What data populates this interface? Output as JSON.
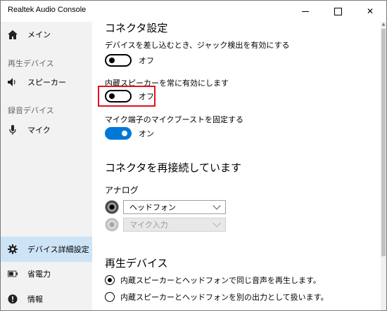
{
  "window": {
    "title": "Realtek Audio Console"
  },
  "sidebar": {
    "main": "メイン",
    "playback_header": "再生デバイス",
    "speaker": "スピーカー",
    "recording_header": "録音デバイス",
    "mic": "マイク",
    "advanced": "デバイス詳細設定",
    "power": "省電力",
    "info": "情報"
  },
  "connector": {
    "title": "コネクタ設定",
    "options": [
      {
        "label": "デバイスを差し込むとき、ジャック検出を有効にする",
        "state": "オフ",
        "on": false
      },
      {
        "label": "内蔵スピーカーを常に有効にします",
        "state": "オフ",
        "on": false
      },
      {
        "label": "マイク端子のマイクブーストを固定する",
        "state": "オン",
        "on": true
      }
    ]
  },
  "reconnect": {
    "title": "コネクタを再接続しています",
    "analog_label": "アナログ",
    "jack1_value": "ヘッドフォン",
    "jack2_value": "マイク入力"
  },
  "playback": {
    "title": "再生デバイス",
    "options": [
      {
        "label": "内蔵スピーカーとヘッドフォンで同じ音声を再生します。",
        "checked": true
      },
      {
        "label": "内蔵スピーカーとヘッドフォンを別の出力として扱います。",
        "checked": false
      }
    ]
  },
  "colors": {
    "accent": "#0078d7",
    "highlight": "#e0141e",
    "selected_nav": "#cde4f7"
  }
}
